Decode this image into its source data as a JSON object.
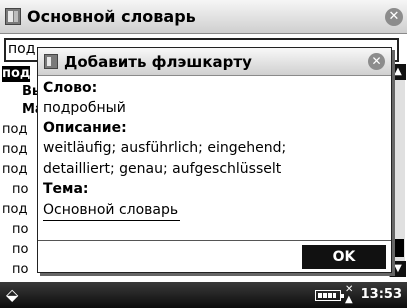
{
  "window": {
    "title": "Основной словарь"
  },
  "search": {
    "value": "под…"
  },
  "list": {
    "items": [
      {
        "text": "под",
        "selected": true
      },
      {
        "text": "Вы"
      },
      {
        "text": "Ма"
      },
      {
        "text": "под"
      },
      {
        "text": "под"
      },
      {
        "text": "под"
      },
      {
        "text": "по"
      },
      {
        "text": "под"
      },
      {
        "text": "по"
      },
      {
        "text": "по"
      },
      {
        "text": "по"
      }
    ]
  },
  "dialog": {
    "title": "Добавить флэшкарту",
    "word_label": "Слово:",
    "word_value": "подробный",
    "description_label": "Описание:",
    "description_line1": "weitläufig; ausführlich; eingehend;",
    "description_line2": "detailliert; genau; aufgeschlüsselt",
    "topic_label": "Тема:",
    "topic_value": "Основной словарь",
    "ok_label": "OK"
  },
  "statusbar": {
    "time": "13:53"
  },
  "icons": {
    "app": "dictionary-icon",
    "close": "close-icon",
    "start": "start-menu-icon",
    "battery": "battery-icon",
    "signal": "signal-icon",
    "scroll_up": "chevron-up-icon",
    "scroll_down": "chevron-down-icon"
  }
}
